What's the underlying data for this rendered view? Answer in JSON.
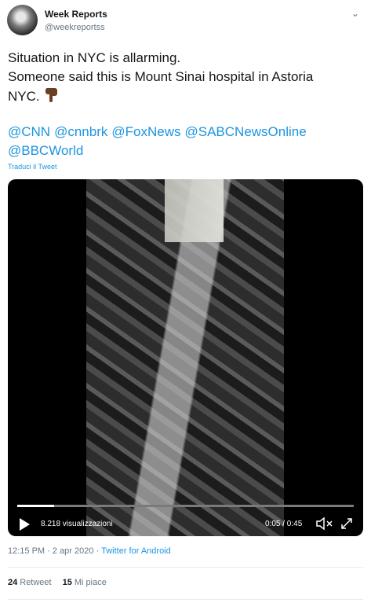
{
  "author": {
    "name": "Week Reports",
    "handle": "@weekreportss",
    "avatar_icon": "avatar-image",
    "menu_icon": "chevron-down-icon"
  },
  "tweet": {
    "line1": "Situation in NYC is allarming.",
    "line2": "Someone said this is Mount Sinai hospital in Astoria",
    "line3": "NYC.",
    "emoji_icon": "pointing-down-emoji",
    "mentions": [
      "@CNN",
      "@cnnbrk",
      "@FoxNews",
      "@SABCNewsOnline",
      "@BBCWorld"
    ],
    "translate_label": "Traduci il Tweet"
  },
  "video": {
    "views": "8.218 visualizzazioni",
    "time": "0:05 / 0:45",
    "progress": 0.11,
    "icons": [
      "play-icon",
      "mute-icon",
      "expand-icon"
    ]
  },
  "meta": {
    "time": "12:15 PM",
    "date": "2 apr 2020",
    "separator": "·",
    "source": "Twitter for Android"
  },
  "stats": {
    "retweets_count": "24",
    "retweets_label": "Retweet",
    "likes_count": "15",
    "likes_label": "Mi piace"
  },
  "colors": {
    "link": "#1b95e0",
    "secondary_text": "#657786",
    "primary_text": "#14171a"
  }
}
